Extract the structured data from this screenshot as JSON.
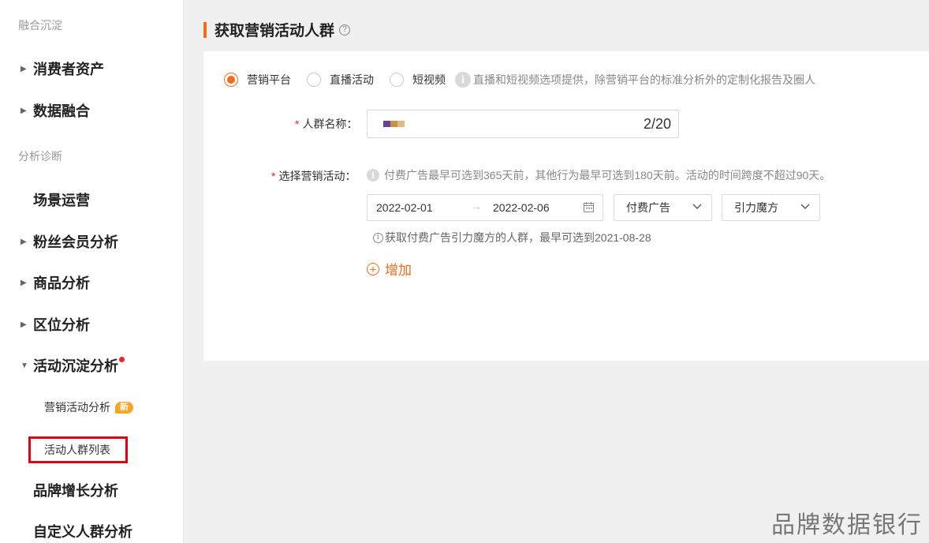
{
  "sidebar": {
    "section1": "融合沉淀",
    "section2": "分析诊断",
    "items": {
      "consumer_assets": "消费者资产",
      "data_fusion": "数据融合",
      "scene_ops": "场景运营",
      "fan_member": "粉丝会员分析",
      "product": "商品分析",
      "location": "区位分析",
      "activity_deposit": "活动沉淀分析",
      "brand_growth": "品牌增长分析",
      "custom_crowd": "自定义人群分析"
    },
    "sub_items": {
      "marketing_analysis": "营销活动分析",
      "new_badge": "新",
      "crowd_list": "活动人群列表"
    }
  },
  "main": {
    "title": "获取营销活动人群",
    "help_icon": "?",
    "radios": [
      {
        "label": "营销平台",
        "checked": true
      },
      {
        "label": "直播活动",
        "checked": false
      },
      {
        "label": "短视频",
        "checked": false
      }
    ],
    "radio_hint": "直播和短视频选项提供，除营销平台的标准分析外的定制化报告及圈人",
    "name_label": "人群名称：",
    "name_count": "2/20",
    "activity_label": "选择营销活动：",
    "activity_hint": "付费广告最早可选到365天前，其他行为最早可选到180天前。活动的时间跨度不超过90天。",
    "date_start": "2022-02-01",
    "date_sep": "→",
    "date_end": "2022-02-06",
    "select_type": "付费广告",
    "select_tool": "引力魔方",
    "sub_hint": "获取付费广告引力魔方的人群，最早可选到2021-08-28",
    "add_label": "增加",
    "required_mark": "*"
  },
  "watermark": "品牌数据银行",
  "colors": {
    "accent": "#f26b1d",
    "highlight": "#e60012",
    "badge": "#f5a623"
  }
}
